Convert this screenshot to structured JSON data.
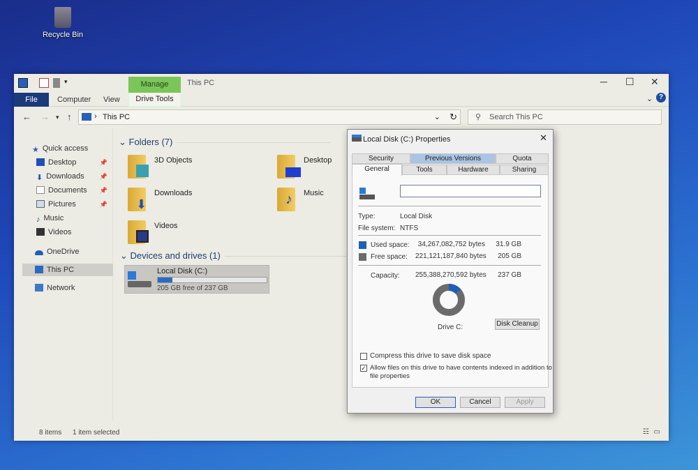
{
  "desktop": {
    "recycle_bin": "Recycle Bin"
  },
  "window": {
    "title": "This PC",
    "manage_tab": "Manage",
    "ribbon": {
      "file": "File",
      "computer": "Computer",
      "view": "View",
      "drive_tools": "Drive Tools"
    },
    "address": {
      "crumb": "This PC",
      "search_placeholder": "Search This PC"
    },
    "sidebar": [
      {
        "label": "Quick access",
        "pinned": false
      },
      {
        "label": "Desktop",
        "pinned": true
      },
      {
        "label": "Downloads",
        "pinned": true
      },
      {
        "label": "Documents",
        "pinned": true
      },
      {
        "label": "Pictures",
        "pinned": true
      },
      {
        "label": "Music",
        "pinned": false
      },
      {
        "label": "Videos",
        "pinned": false
      },
      {
        "label": "OneDrive",
        "pinned": false
      },
      {
        "label": "This PC",
        "pinned": false
      },
      {
        "label": "Network",
        "pinned": false
      }
    ],
    "folders_header": "Folders (7)",
    "folders": [
      "3D Objects",
      "Desktop",
      "Downloads",
      "Music",
      "Videos"
    ],
    "devices_header": "Devices and drives (1)",
    "drive": {
      "name": "Local Disk (C:)",
      "free_text": "205 GB free of 237 GB",
      "used_fraction": 0.134
    },
    "status": {
      "items": "8 items",
      "selected": "1 item selected"
    }
  },
  "dialog": {
    "title": "Local Disk (C:) Properties",
    "tabs_back": [
      "Security",
      "Previous Versions",
      "Quota"
    ],
    "tabs_front": [
      "General",
      "Tools",
      "Hardware",
      "Sharing"
    ],
    "name_value": "",
    "type_label": "Type:",
    "type_value": "Local Disk",
    "fs_label": "File system:",
    "fs_value": "NTFS",
    "used_label": "Used space:",
    "used_bytes": "34,267,082,752 bytes",
    "used_gb": "31.9 GB",
    "free_label": "Free space:",
    "free_bytes": "221,121,187,840 bytes",
    "free_gb": "205 GB",
    "cap_label": "Capacity:",
    "cap_bytes": "255,388,270,592 bytes",
    "cap_gb": "237 GB",
    "drive_label": "Drive C:",
    "cleanup": "Disk Cleanup",
    "compress": "Compress this drive to save disk space",
    "compress_checked": false,
    "index_line1": "Allow files on this drive to have contents indexed in addition to",
    "index_line2": "file properties",
    "index_checked": true,
    "ok": "OK",
    "cancel": "Cancel",
    "apply": "Apply",
    "colors": {
      "used": "#1f5fb4",
      "free": "#6b6b6b"
    }
  }
}
